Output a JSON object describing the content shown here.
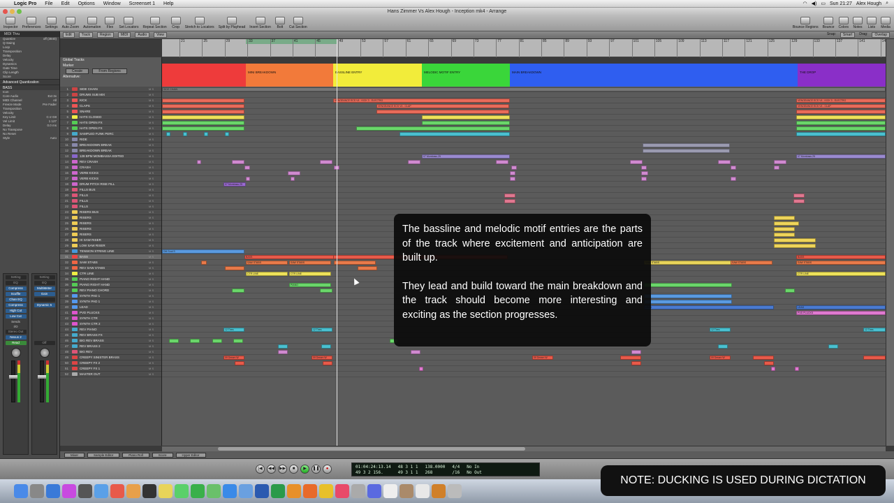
{
  "menubar": {
    "app": "Logic Pro",
    "items": [
      "File",
      "Edit",
      "Options",
      "Window",
      "Screenset 1",
      "Help"
    ],
    "clock": "Sun 21:27",
    "user": "Alex Hough"
  },
  "window": {
    "title": "Hans Zimmer Vs Alex Hough - Inception mk4 - Arrange"
  },
  "toolbar": {
    "left": [
      "Inspector",
      "Preferences",
      "Settings"
    ],
    "middle": [
      "Auto Zoom",
      "Automation",
      "Flex",
      "Set Locators",
      "Repeat Section",
      "Crop",
      "Stretch to Locators",
      "Split by Playhead",
      "Insert Section",
      "Bolt",
      "Cut Section"
    ],
    "right": [
      "Bounce Regions",
      "Bounce",
      "Colors",
      "Notes",
      "Lists",
      "Media"
    ]
  },
  "subtoolbar": {
    "items": [
      "Edit",
      "Track",
      "Region",
      "MIDI",
      "Audio",
      "View"
    ],
    "snap_label": "Snap:",
    "snap_value": "Smart",
    "drag_label": "Drag:",
    "drag_value": "Overlap"
  },
  "inspector": {
    "top": "MIDI Thru",
    "params": [
      {
        "k": "Quantize",
        "v": "off (3840)"
      },
      {
        "k": "Q-Swing",
        "v": ""
      },
      {
        "k": "Loop",
        "v": ""
      },
      {
        "k": "Transposition",
        "v": ""
      },
      {
        "k": "Delay",
        "v": ""
      },
      {
        "k": "Velocity",
        "v": ""
      },
      {
        "k": "Dynamics",
        "v": ""
      },
      {
        "k": "Gate Time",
        "v": ""
      },
      {
        "k": "Clip Length",
        "v": ""
      },
      {
        "k": "Score",
        "v": ""
      }
    ],
    "advanced": "Advanced Quantization",
    "track_section": "BASS",
    "track_params": [
      {
        "k": "Icon",
        "v": ""
      },
      {
        "k": "Core Audio",
        "v": "Ext 3x"
      },
      {
        "k": "MIDI Channel",
        "v": "All"
      },
      {
        "k": "Freeze Mode",
        "v": "Pre Fader"
      },
      {
        "k": "Transposition",
        "v": ""
      },
      {
        "k": "Velocity",
        "v": ""
      },
      {
        "k": "Key Limit",
        "v": "C-2  G8"
      },
      {
        "k": "Vel Limit",
        "v": "1  127"
      },
      {
        "k": "Delay",
        "v": "0.0 ms"
      },
      {
        "k": "No Transpose",
        "v": ""
      },
      {
        "k": "No Reset",
        "v": ""
      },
      {
        "k": "Style",
        "v": "Auto"
      }
    ],
    "strip1": {
      "setting": "Setting",
      "eq": "EQ",
      "inserts": [
        "Compress",
        "Scuffle",
        "Chan EQ",
        "Compress",
        "High Cut",
        "Low Cut"
      ],
      "sends": "Sends",
      "io": "I/O",
      "out": "Stereo Out",
      "group": "Nexus 2",
      "mode": "Read",
      "name": "BASS"
    },
    "strip2": {
      "setting": "Setting",
      "eq": "EQ",
      "inserts": [
        "MultiMeter",
        "Gain",
        "",
        "Dynamic 5"
      ],
      "mode": "Off",
      "name": "MASTER O"
    }
  },
  "global_tracks": {
    "title": "Global Tracks",
    "marker": "Marker",
    "create": "Create",
    "from_regions": "From Regions",
    "alternative": "Alternative:"
  },
  "ruler": {
    "bars": [
      "21",
      "25",
      "29",
      "33",
      "37",
      "41",
      "45",
      "49",
      "53",
      "57",
      "61",
      "65",
      "69",
      "73",
      "77",
      "81",
      "85",
      "89",
      "93",
      "97",
      "101",
      "105",
      "109",
      "113",
      "117",
      "121",
      "125",
      "129",
      "133",
      "137",
      "141",
      "145"
    ]
  },
  "markers": [
    {
      "name": "",
      "color": "#ee3b3b"
    },
    {
      "name": "MINI BREAKDOWN",
      "color": "#f27a3a"
    },
    {
      "name": "BASSLINE ENTRY",
      "color": "#f2ec3a"
    },
    {
      "name": "MELODIC MOTIF ENTRY",
      "color": "#3ad63a"
    },
    {
      "name": "MAIN BREAKDOWN",
      "color": "#2f5ef0"
    },
    {
      "name": "THE DROP",
      "color": "#8a2fc8"
    }
  ],
  "tracks": [
    {
      "n": "1",
      "name": "SIDE CHAIN",
      "c": "#c44"
    },
    {
      "n": "2",
      "name": "DRUMS SUB MIX",
      "c": "#c44"
    },
    {
      "n": "3",
      "name": "KICK",
      "c": "#e55"
    },
    {
      "n": "4",
      "name": "CLAPS",
      "c": "#e55"
    },
    {
      "n": "5",
      "name": "SNARE",
      "c": "#e55"
    },
    {
      "n": "6",
      "name": "HATS CLOSED",
      "c": "#ee4"
    },
    {
      "n": "7",
      "name": "HATS OPEN FX",
      "c": "#5c5"
    },
    {
      "n": "8",
      "name": "HATS OPEN FX",
      "c": "#5c5"
    },
    {
      "n": "9",
      "name": "SAMPLED FUNK PERC",
      "c": "#4ac"
    },
    {
      "n": "10",
      "name": "RIDE",
      "c": "#88a"
    },
    {
      "n": "11",
      "name": "BREAKDOWN BREAK",
      "c": "#88a"
    },
    {
      "n": "12",
      "name": "BREAKDOWN BREAK",
      "c": "#88a"
    },
    {
      "n": "13",
      "name": "128 BPM MOMBASSA EDITED",
      "c": "#86c"
    },
    {
      "n": "14",
      "name": "REV CRASH",
      "c": "#c6c"
    },
    {
      "n": "15",
      "name": "CRASH",
      "c": "#c6c"
    },
    {
      "n": "16",
      "name": "VERB KICKS",
      "c": "#c6c"
    },
    {
      "n": "17",
      "name": "VERB KICKS",
      "c": "#c6c"
    },
    {
      "n": "18",
      "name": "DRUM PITCH RISE FILL",
      "c": "#c6c"
    },
    {
      "n": "19",
      "name": "FILLS BUS",
      "c": "#d57"
    },
    {
      "n": "20",
      "name": "FILLS",
      "c": "#d57"
    },
    {
      "n": "21",
      "name": "FILLS",
      "c": "#d57"
    },
    {
      "n": "22",
      "name": "FILLS",
      "c": "#d57"
    },
    {
      "n": "23",
      "name": "RISERS BUS",
      "c": "#ec5"
    },
    {
      "n": "24",
      "name": "RISERS",
      "c": "#ec5"
    },
    {
      "n": "25",
      "name": "RISERS",
      "c": "#ec5"
    },
    {
      "n": "26",
      "name": "RISERS",
      "c": "#ec5"
    },
    {
      "n": "27",
      "name": "RISERS",
      "c": "#ec5"
    },
    {
      "n": "28",
      "name": "HI SAW RISER",
      "c": "#ec5"
    },
    {
      "n": "29",
      "name": "LOW SAW RISER",
      "c": "#ec5"
    },
    {
      "n": "30",
      "name": "TENSION STRING LINE",
      "c": "#49d"
    },
    {
      "n": "31",
      "name": "BASS",
      "c": "#e44"
    },
    {
      "n": "32",
      "name": "SAW STABS",
      "c": "#e64"
    },
    {
      "n": "33",
      "name": "REV SAW STABS",
      "c": "#e64"
    },
    {
      "n": "34",
      "name": "CTR LINE",
      "c": "#ee4"
    },
    {
      "n": "35",
      "name": "PIANO RIGHT HAND",
      "c": "#5c5"
    },
    {
      "n": "36",
      "name": "PIANO RIGHT HAND",
      "c": "#5c5"
    },
    {
      "n": "37",
      "name": "REV PIANO CHORD",
      "c": "#5c5"
    },
    {
      "n": "38",
      "name": "SYNTH PAD 1",
      "c": "#59e"
    },
    {
      "n": "39",
      "name": "SYNTH PAD 1",
      "c": "#59e"
    },
    {
      "n": "40",
      "name": "LEAD",
      "c": "#59e"
    },
    {
      "n": "41",
      "name": "PVD PLUCKS",
      "c": "#d5c"
    },
    {
      "n": "42",
      "name": "SYNTH CTR",
      "c": "#d5c"
    },
    {
      "n": "43",
      "name": "SYNTH CTR 2",
      "c": "#d5c"
    },
    {
      "n": "44",
      "name": "REV PIANO",
      "c": "#4ac"
    },
    {
      "n": "45",
      "name": "REV BRASS FX",
      "c": "#4ac"
    },
    {
      "n": "46",
      "name": "BIG REV BRASS",
      "c": "#4ac"
    },
    {
      "n": "47",
      "name": "REV BRASS 2",
      "c": "#4ac"
    },
    {
      "n": "48",
      "name": "BIG REV",
      "c": "#d57"
    },
    {
      "n": "49",
      "name": "CREEPY SINISTER BRASS",
      "c": "#d44"
    },
    {
      "n": "50",
      "name": "CREEPY FX 2",
      "c": "#d44"
    },
    {
      "n": "51",
      "name": "CREEPY FX 1",
      "c": "#d44"
    },
    {
      "n": "52",
      "name": "MASTER OUT",
      "c": "#aaa"
    }
  ],
  "regions": {
    "side_chain": "SIDE CHAIN",
    "kick": "VENGEANCE ECS V4 - KICK 3 - ELECTRO",
    "claps": "VENGEANCE ECS V4 - CLAP",
    "bass": "BASS",
    "saw_stabs": "SAW STABS",
    "ctr_line": "CTR LINE",
    "piano": "PIANO",
    "lead": "LEAD",
    "pvd": "PVD PLUCKS",
    "rev_piano": "12 Tires",
    "mombassa": "07 Mombass.25",
    "dream": "09 Dream W",
    "tension": "DM Soul S"
  },
  "bottom_buttons": [
    "Mixer",
    "Sample Editor",
    "Piano Roll",
    "Score",
    "Hyper Editor"
  ],
  "transport": {
    "smpte": "01:04:24:13.14",
    "bars": "49  3  2  156.",
    "pos": "48  3  1  1",
    "pos2": "49  3  1  1",
    "tempo": "138.0000",
    "tempo2": "268",
    "sig": "4/4",
    "div": "/16",
    "in": "No In",
    "out": "No Out"
  },
  "caption": {
    "p1": "The bassline and melodic motif entries are the parts of the track where excitement and anticipation are built up.",
    "p2": "They lead and build toward the main breakdown and the track should become more interesting and exciting as the section progresses."
  },
  "note": "NOTE: DUCKING IS USED DURING DICTATION"
}
